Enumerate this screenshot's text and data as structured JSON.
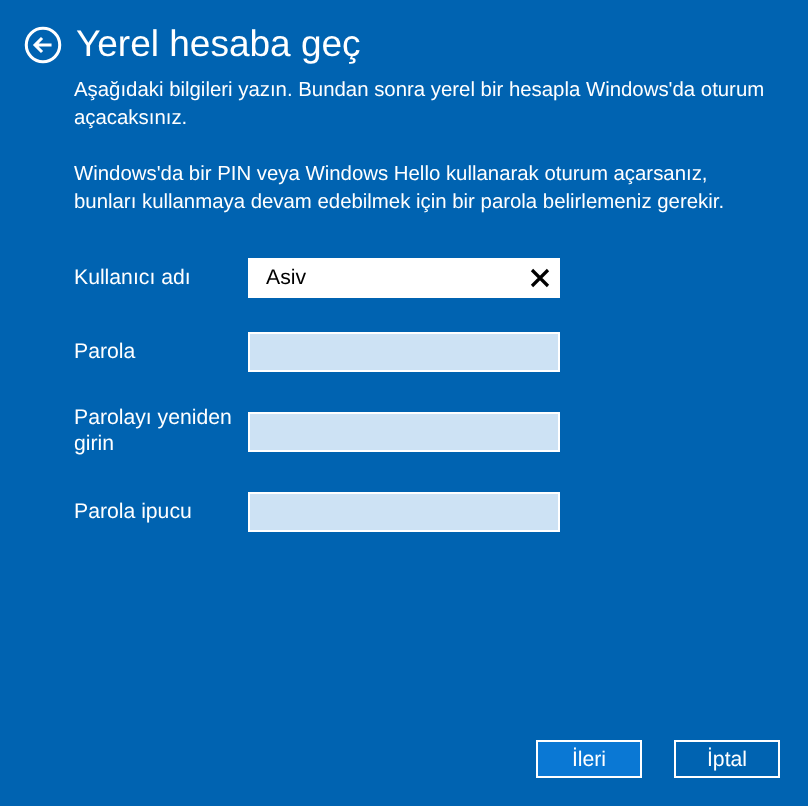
{
  "header": {
    "title": "Yerel hesaba geç"
  },
  "paragraphs": [
    "Aşağıdaki bilgileri yazın. Bundan sonra yerel bir hesapla Windows'da oturum açacaksınız.",
    "Windows'da bir PIN veya Windows Hello kullanarak oturum açarsanız, bunları kullanmaya devam edebilmek için bir parola belirlemeniz gerekir."
  ],
  "fields": [
    {
      "label": "Kullanıcı adı",
      "value": "Asiv",
      "focused": true
    },
    {
      "label": "Parola",
      "focused": false
    },
    {
      "label": "Parolayı yeniden girin",
      "focused": false
    },
    {
      "label": "Parola ipucu",
      "focused": false
    }
  ],
  "buttons": [
    {
      "label": "İleri",
      "default": true
    },
    {
      "label": "İptal",
      "default": false
    }
  ]
}
